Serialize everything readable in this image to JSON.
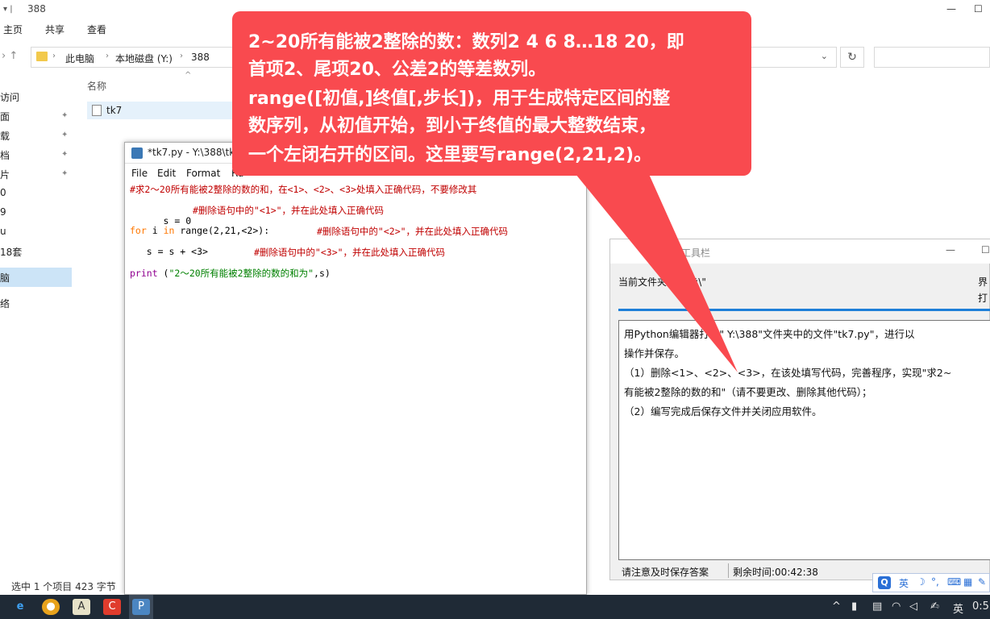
{
  "explorer": {
    "title": "388",
    "ribbon_tabs": [
      "主页",
      "共享",
      "查看"
    ],
    "breadcrumb": [
      "此电脑",
      "本地磁盘 (Y:)",
      "388"
    ],
    "column_header": "名称",
    "file_name": "tk7",
    "sidebar_items": [
      "访问",
      "面",
      "载",
      "档",
      "片",
      "0",
      "9",
      "u",
      "18套",
      "脑",
      "络"
    ],
    "status": "选中 1 个项目  423 字节"
  },
  "editor": {
    "title": "*tk7.py - Y:\\388\\tk7",
    "menu": [
      "File",
      "Edit",
      "Format",
      "Ru"
    ],
    "code": {
      "line1": "#求2～20所有能被2整除的数的和，在<1>、<2>、<3>处填入正确代码，不要修改其",
      "line2_code": "s = 0",
      "line2_comment": "#删除语句中的\"<1>\"，并在此处填入正确代码",
      "line3_kw1": "for",
      "line3_var": " i ",
      "line3_kw2": "in",
      "line3_rest": " range(2,21,<2>):",
      "line3_comment": "#删除语句中的\"<2>\"，并在此处填入正确代码",
      "line4_code": "   s = s + <3>",
      "line4_comment": "#删除语句中的\"<3>\"，并在此处填入正确代码",
      "line5_fn": "print",
      "line5_open": " (",
      "line5_str": "\"2～20所有能被2整除的数的和为\"",
      "line5_close": ",s)"
    }
  },
  "examtool": {
    "title": "考题提示工具栏",
    "folder": "当前文件夹为：\"Y:\\\"",
    "right1": "界",
    "right2": "打",
    "lines": [
      "用Python编辑器打开\" Y:\\388\"文件夹中的文件\"tk7.py\"，进行以",
      "操作并保存。",
      "（1）删除<1>、<2>、<3>，在该处填写代码，完善程序，实现\"求2~",
      "有能被2整除的数的和\"（请不要更改、删除其他代码）；",
      "（2）编写完成后保存文件并关闭应用软件。"
    ],
    "note": "请注意及时保存答案",
    "timer": "剩余时间:00:42:38"
  },
  "callout": {
    "lines": [
      "2~20所有能被2整除的数：数列2 4 6 8…18 20，即",
      "首项2、尾项20、公差2的等差数列。",
      "range([初值,]终值[,步长])，用于生成特定区间的整",
      "数序列，从初值开始，到小于终值的最大整数结束，",
      "一个左闭右开的区间。这里要写range(2,21,2)。"
    ]
  },
  "ime": {
    "lang": "英"
  },
  "taskbar": {
    "lang": "英",
    "clock": "0:5"
  },
  "colors": {
    "callout": "#f94a4f",
    "taskbar": "#1f2a36",
    "accent": "#1e7fd8"
  }
}
